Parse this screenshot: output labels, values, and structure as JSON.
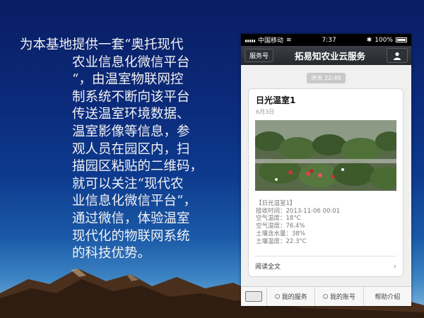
{
  "slide": {
    "lines": [
      "为本基地提供一套“奥托现代",
      "农业信息化微信平台",
      "“，由温室物联网控",
      "制系统不断向该平台",
      "传送温室环境数据、",
      "温室影像等信息，参",
      "观人员在园区内，扫",
      "描园区粘贴的二维码，",
      "就可以关注“现代农",
      "业信息化微信平台“，",
      "通过微信，体验温室",
      "现代化的物联网系统",
      "的科技优势。"
    ]
  },
  "phone": {
    "status_bar": {
      "carrier": "中国移动",
      "time": "7:37",
      "battery": "100%"
    },
    "nav": {
      "back_label": "服务号",
      "title": "拓易知农业云服务"
    },
    "date_badge": "昨天 22:49",
    "card": {
      "title": "日光温室1",
      "date": "6月3日",
      "lines": [
        "【日光温室1】",
        "接收时间：2013-11-06 00:01",
        "空气温度：18°C",
        "空气湿度：76.4%",
        "土壤含水量：38%",
        "土壤温度：22.3°C"
      ],
      "read_more": "阅读全文"
    },
    "bottom_menu": [
      "我的服务",
      "我的账号",
      "帮助介绍"
    ]
  },
  "colors": {
    "slide_bg_top": "#0a1d63",
    "slide_bg_bottom": "#8bbfe4",
    "nav_bg": "#2a2d31"
  }
}
